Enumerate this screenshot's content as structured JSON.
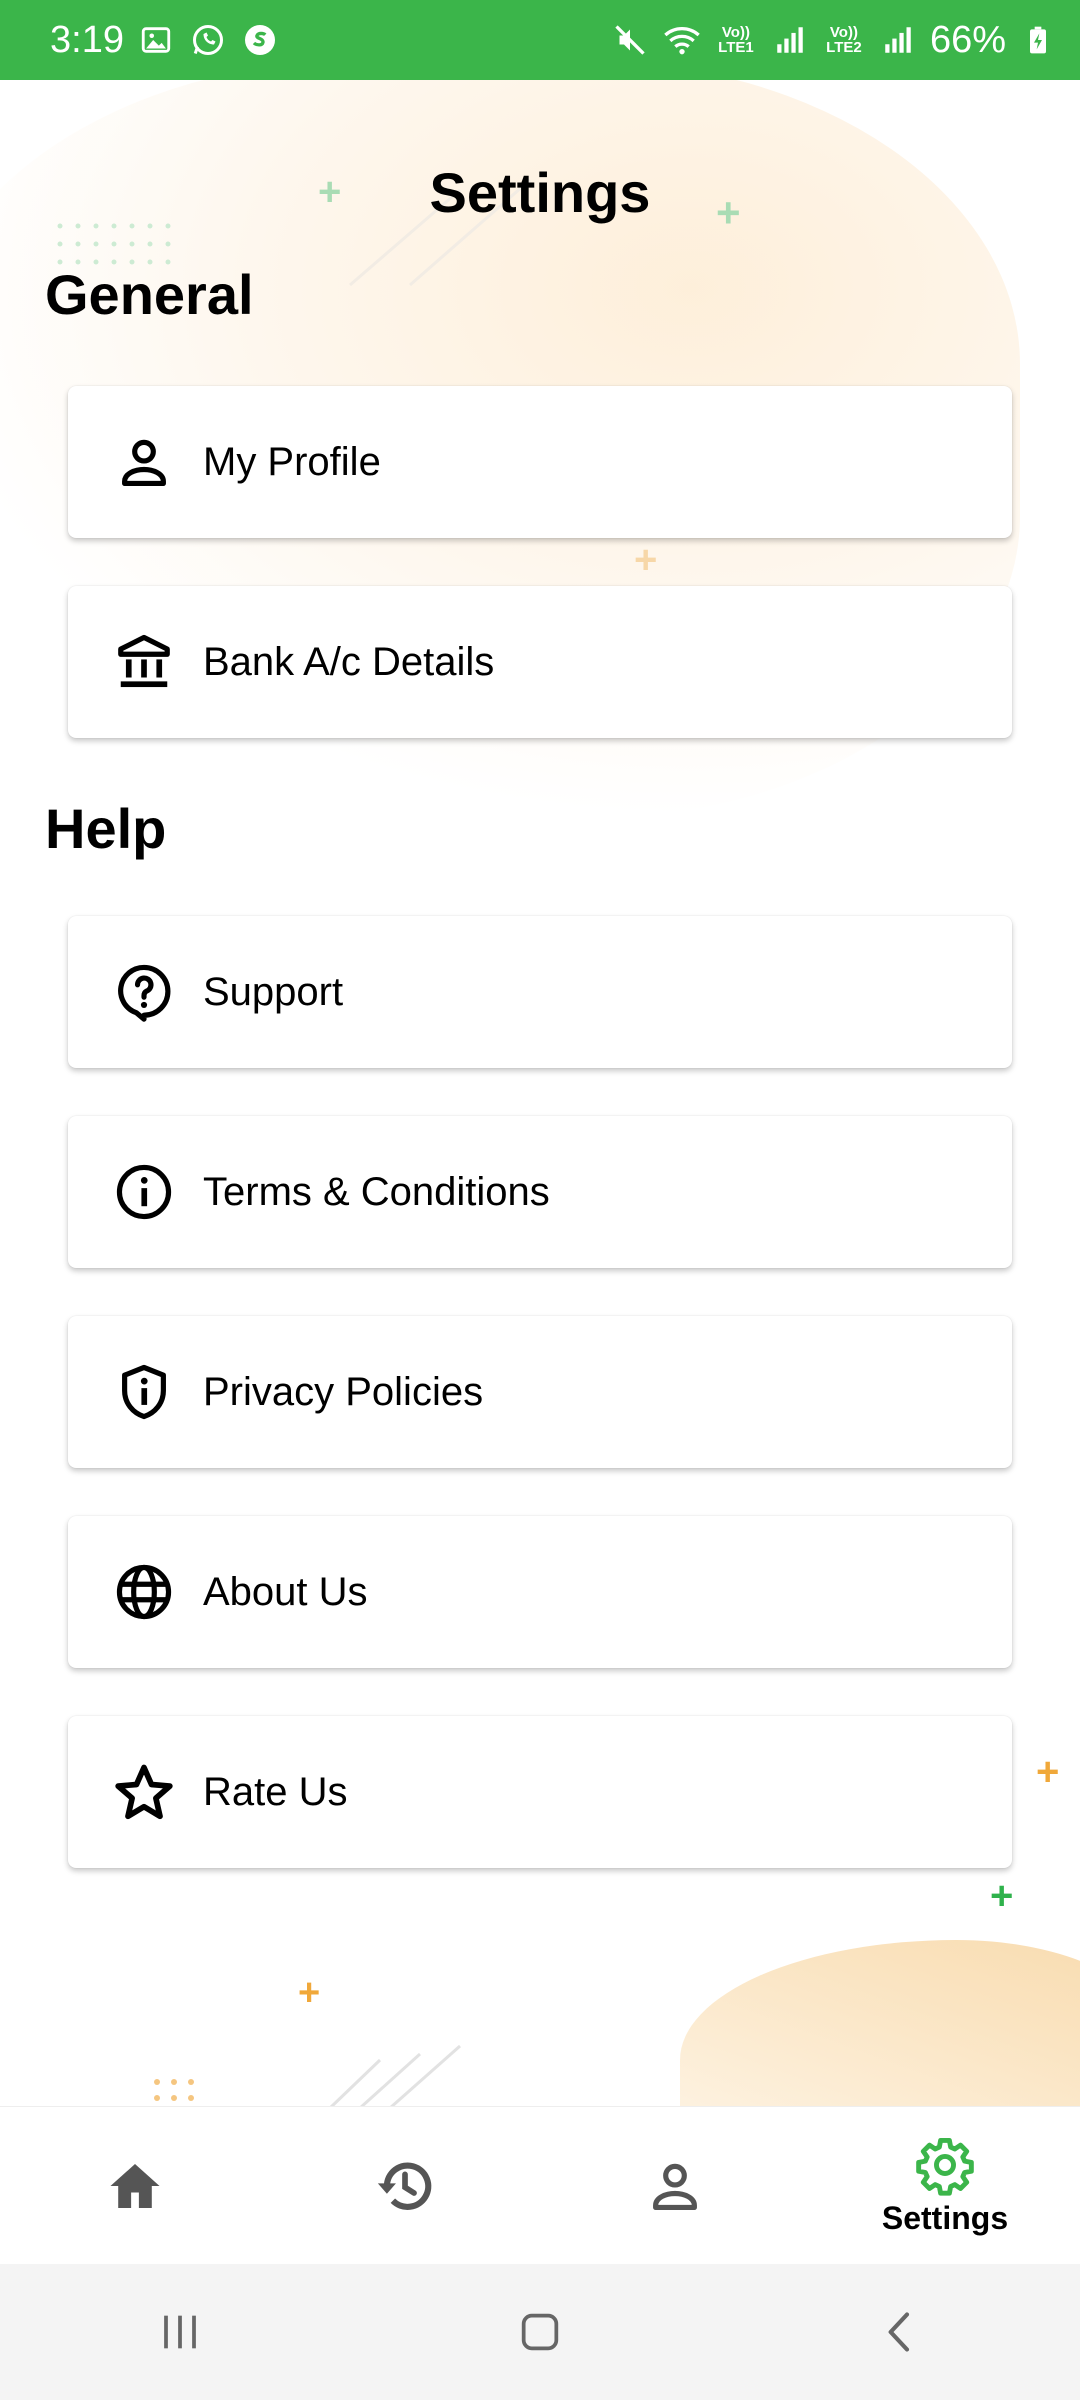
{
  "status_bar": {
    "time": "3:19",
    "battery": "66%",
    "lte1": "Vo)) LTE1",
    "lte2": "Vo)) LTE2"
  },
  "page": {
    "title": "Settings"
  },
  "sections": {
    "general": {
      "title": "General",
      "items": [
        {
          "label": "My Profile",
          "icon": "person-icon"
        },
        {
          "label": "Bank A/c Details",
          "icon": "bank-icon"
        }
      ]
    },
    "help": {
      "title": "Help",
      "items": [
        {
          "label": "Support",
          "icon": "help-chat-icon"
        },
        {
          "label": "Terms & Conditions",
          "icon": "info-icon"
        },
        {
          "label": "Privacy Policies",
          "icon": "shield-info-icon"
        },
        {
          "label": "About Us",
          "icon": "globe-icon"
        },
        {
          "label": "Rate Us",
          "icon": "star-icon"
        }
      ]
    }
  },
  "bottom_nav": {
    "items": [
      {
        "name": "home",
        "icon": "home-icon",
        "label": ""
      },
      {
        "name": "history",
        "icon": "history-icon",
        "label": ""
      },
      {
        "name": "profile",
        "icon": "person-icon",
        "label": ""
      },
      {
        "name": "settings",
        "icon": "gear-icon",
        "label": "Settings",
        "active": true
      }
    ]
  },
  "colors": {
    "status_bar": "#3bb54a",
    "accent_green": "#3bb54a",
    "inactive_icon": "#555555",
    "deco_orange": "#f0a83a",
    "deco_green": "#2fb24c"
  }
}
